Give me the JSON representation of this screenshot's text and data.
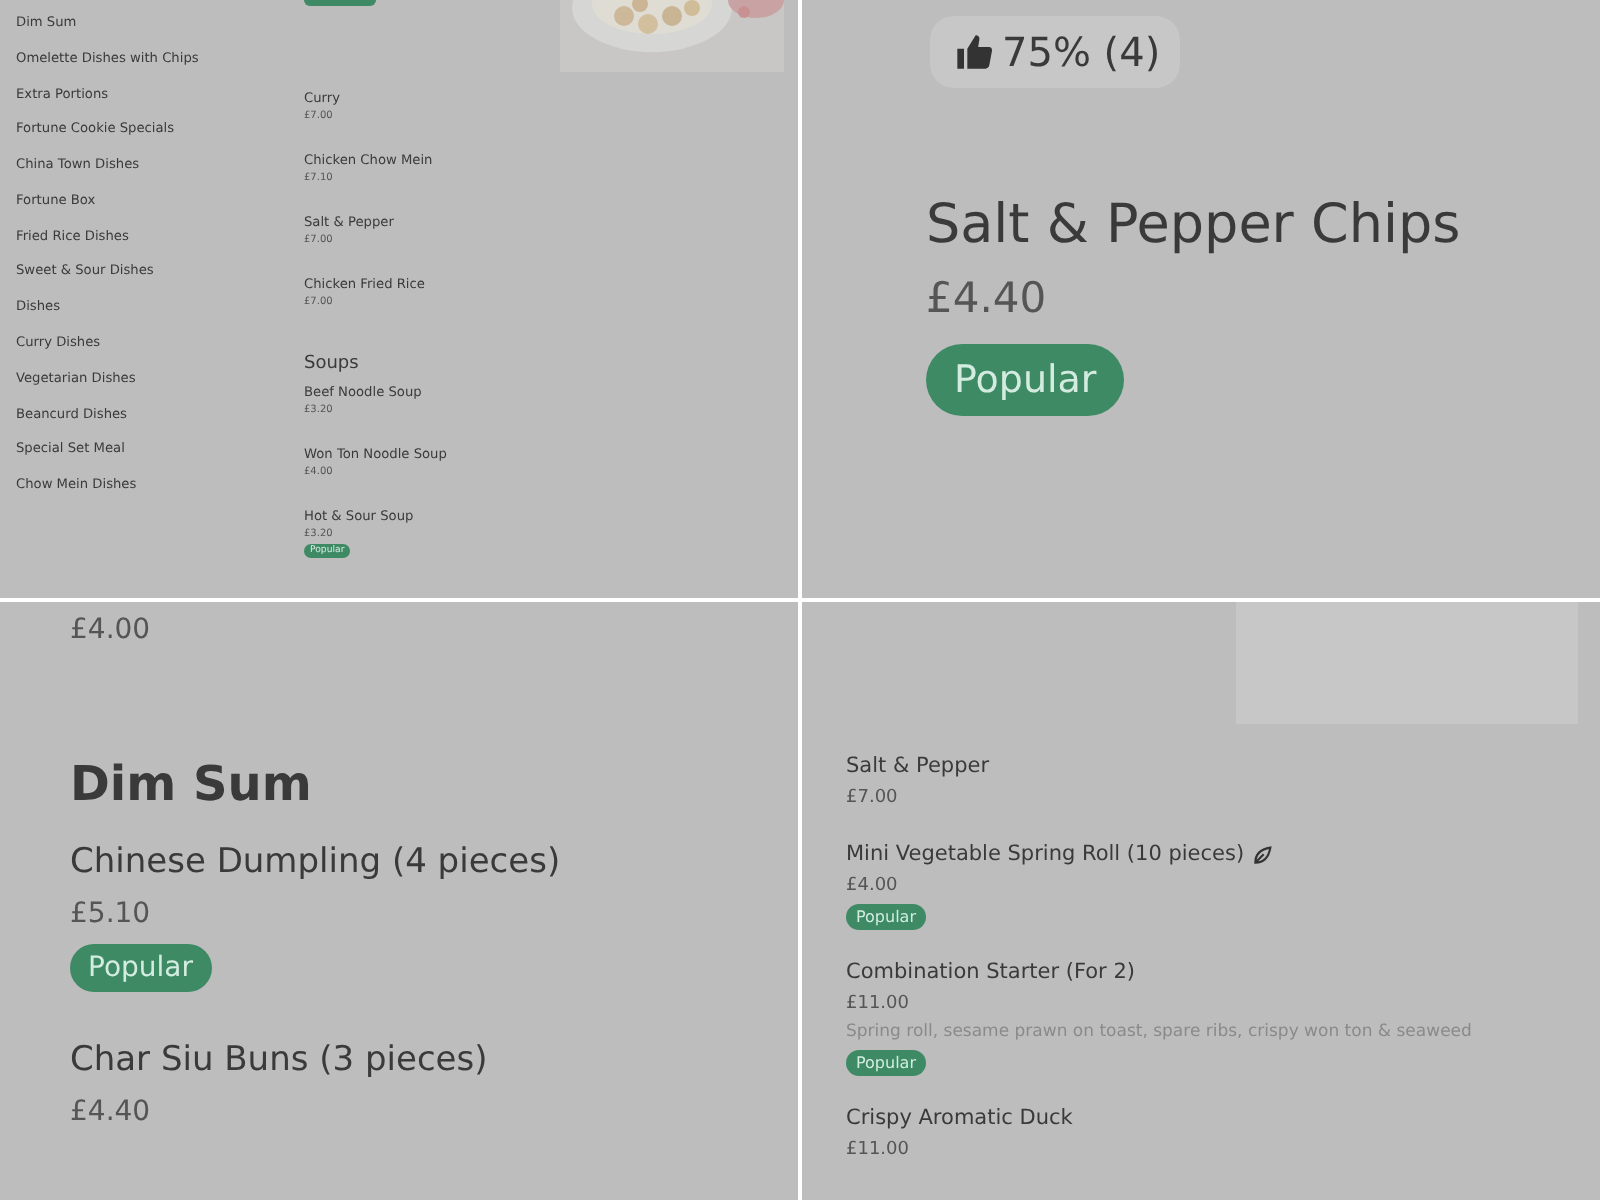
{
  "panels": [
    {
      "kind": "small",
      "cut_badge": true,
      "categories": [
        {
          "label": "Dim Sum"
        },
        {
          "label": "Omelette Dishes with Chips"
        },
        {
          "label": "Extra Portions"
        },
        {
          "label": "Fortune Cookie Specials"
        },
        {
          "label": "China Town Dishes"
        },
        {
          "label": "Fortune Box"
        },
        {
          "label": "Fried Rice Dishes"
        },
        {
          "label": "Sweet & Sour Dishes"
        },
        {
          "label": "Dishes"
        },
        {
          "label": "Curry Dishes"
        },
        {
          "label": "Vegetarian Dishes"
        },
        {
          "label": "Beancurd Dishes"
        },
        {
          "label": "Special Set Meal"
        },
        {
          "label": "Chow Mein Dishes"
        }
      ],
      "entries": [
        {
          "kind": "item",
          "name": "Curry",
          "price": "£7.00",
          "popular": false
        },
        {
          "kind": "item",
          "name": "Chicken Chow Mein",
          "price": "£7.10",
          "popular": false
        },
        {
          "kind": "item",
          "name": "Salt & Pepper",
          "price": "£7.00",
          "popular": false
        },
        {
          "kind": "item",
          "name": "Chicken Fried Rice",
          "price": "£7.00",
          "popular": false
        },
        {
          "kind": "heading",
          "title": "Soups"
        },
        {
          "kind": "item",
          "name": "Beef Noodle Soup",
          "price": "£3.20",
          "popular": false
        },
        {
          "kind": "item",
          "name": "Won Ton Noodle Soup",
          "price": "£4.00",
          "popular": false
        },
        {
          "kind": "item",
          "name": "Hot & Sour Soup",
          "price": "£3.20",
          "popular": true,
          "badge": "Popular"
        }
      ]
    },
    {
      "kind": "detail",
      "entries": [
        {
          "kind": "rating",
          "text": "75% (4)"
        },
        {
          "kind": "item",
          "name": "Salt & Pepper Chips",
          "price": "£4.40",
          "popular": true,
          "badge": "Popular"
        }
      ]
    },
    {
      "kind": "large",
      "entries": [
        {
          "kind": "price",
          "price": "£4.00"
        },
        {
          "kind": "heading",
          "title": "Dim Sum"
        },
        {
          "kind": "item",
          "name": "Chinese Dumpling (4 pieces)",
          "price": "£5.10",
          "popular": true,
          "badge": "Popular"
        },
        {
          "kind": "item",
          "name": "Char Siu Buns (3 pieces)",
          "price": "£4.40",
          "popular": false
        }
      ]
    },
    {
      "kind": "medium",
      "image_placeholder": true,
      "entries": [
        {
          "kind": "item",
          "name": "Salt & Pepper",
          "price": "£7.00",
          "popular": false
        },
        {
          "kind": "item",
          "name": "Mini Vegetable Spring Roll (10 pieces)",
          "vegetarian": true,
          "price": "£4.00",
          "popular": true,
          "badge": "Popular"
        },
        {
          "kind": "item",
          "name": "Combination Starter (For 2)",
          "price": "£11.00",
          "description": "Spring roll, sesame prawn on toast, spare ribs, crispy won ton & seaweed",
          "popular": true,
          "badge": "Popular"
        },
        {
          "kind": "item",
          "name": "Crispy Aromatic Duck",
          "price": "£11.00",
          "popular": false
        }
      ]
    }
  ]
}
